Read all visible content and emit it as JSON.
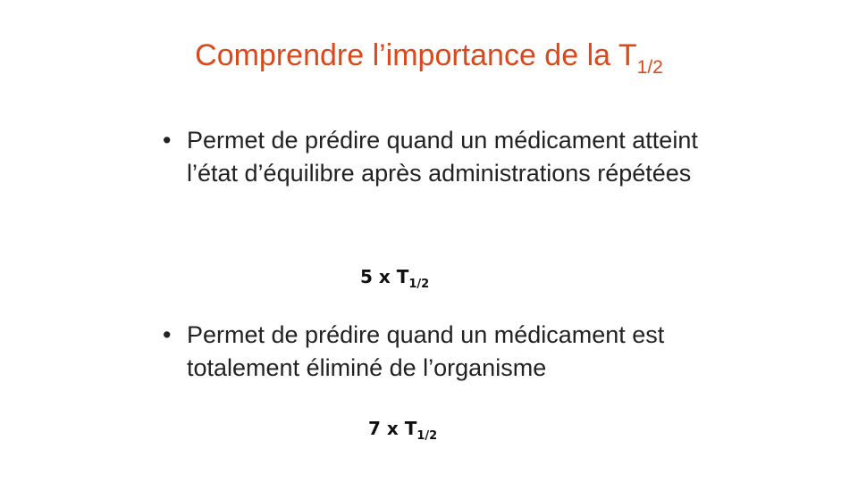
{
  "title": {
    "main": "Comprendre l’importance de la T",
    "subscript": "1/2"
  },
  "bullets": [
    {
      "marker": "•",
      "text": "Permet de prédire quand un médicament atteint l’état d’équilibre après administrations répétées"
    },
    {
      "marker": "•",
      "text": "Permet de prédire quand un médicament est totalement éliminé de l’organisme"
    }
  ],
  "formulas": [
    {
      "main": "5 x T",
      "subscript": "1/2"
    },
    {
      "main": "7 x T",
      "subscript": "1/2"
    }
  ],
  "colors": {
    "title": "#d9491c",
    "body_text": "#222222",
    "background": "#ffffff"
  }
}
